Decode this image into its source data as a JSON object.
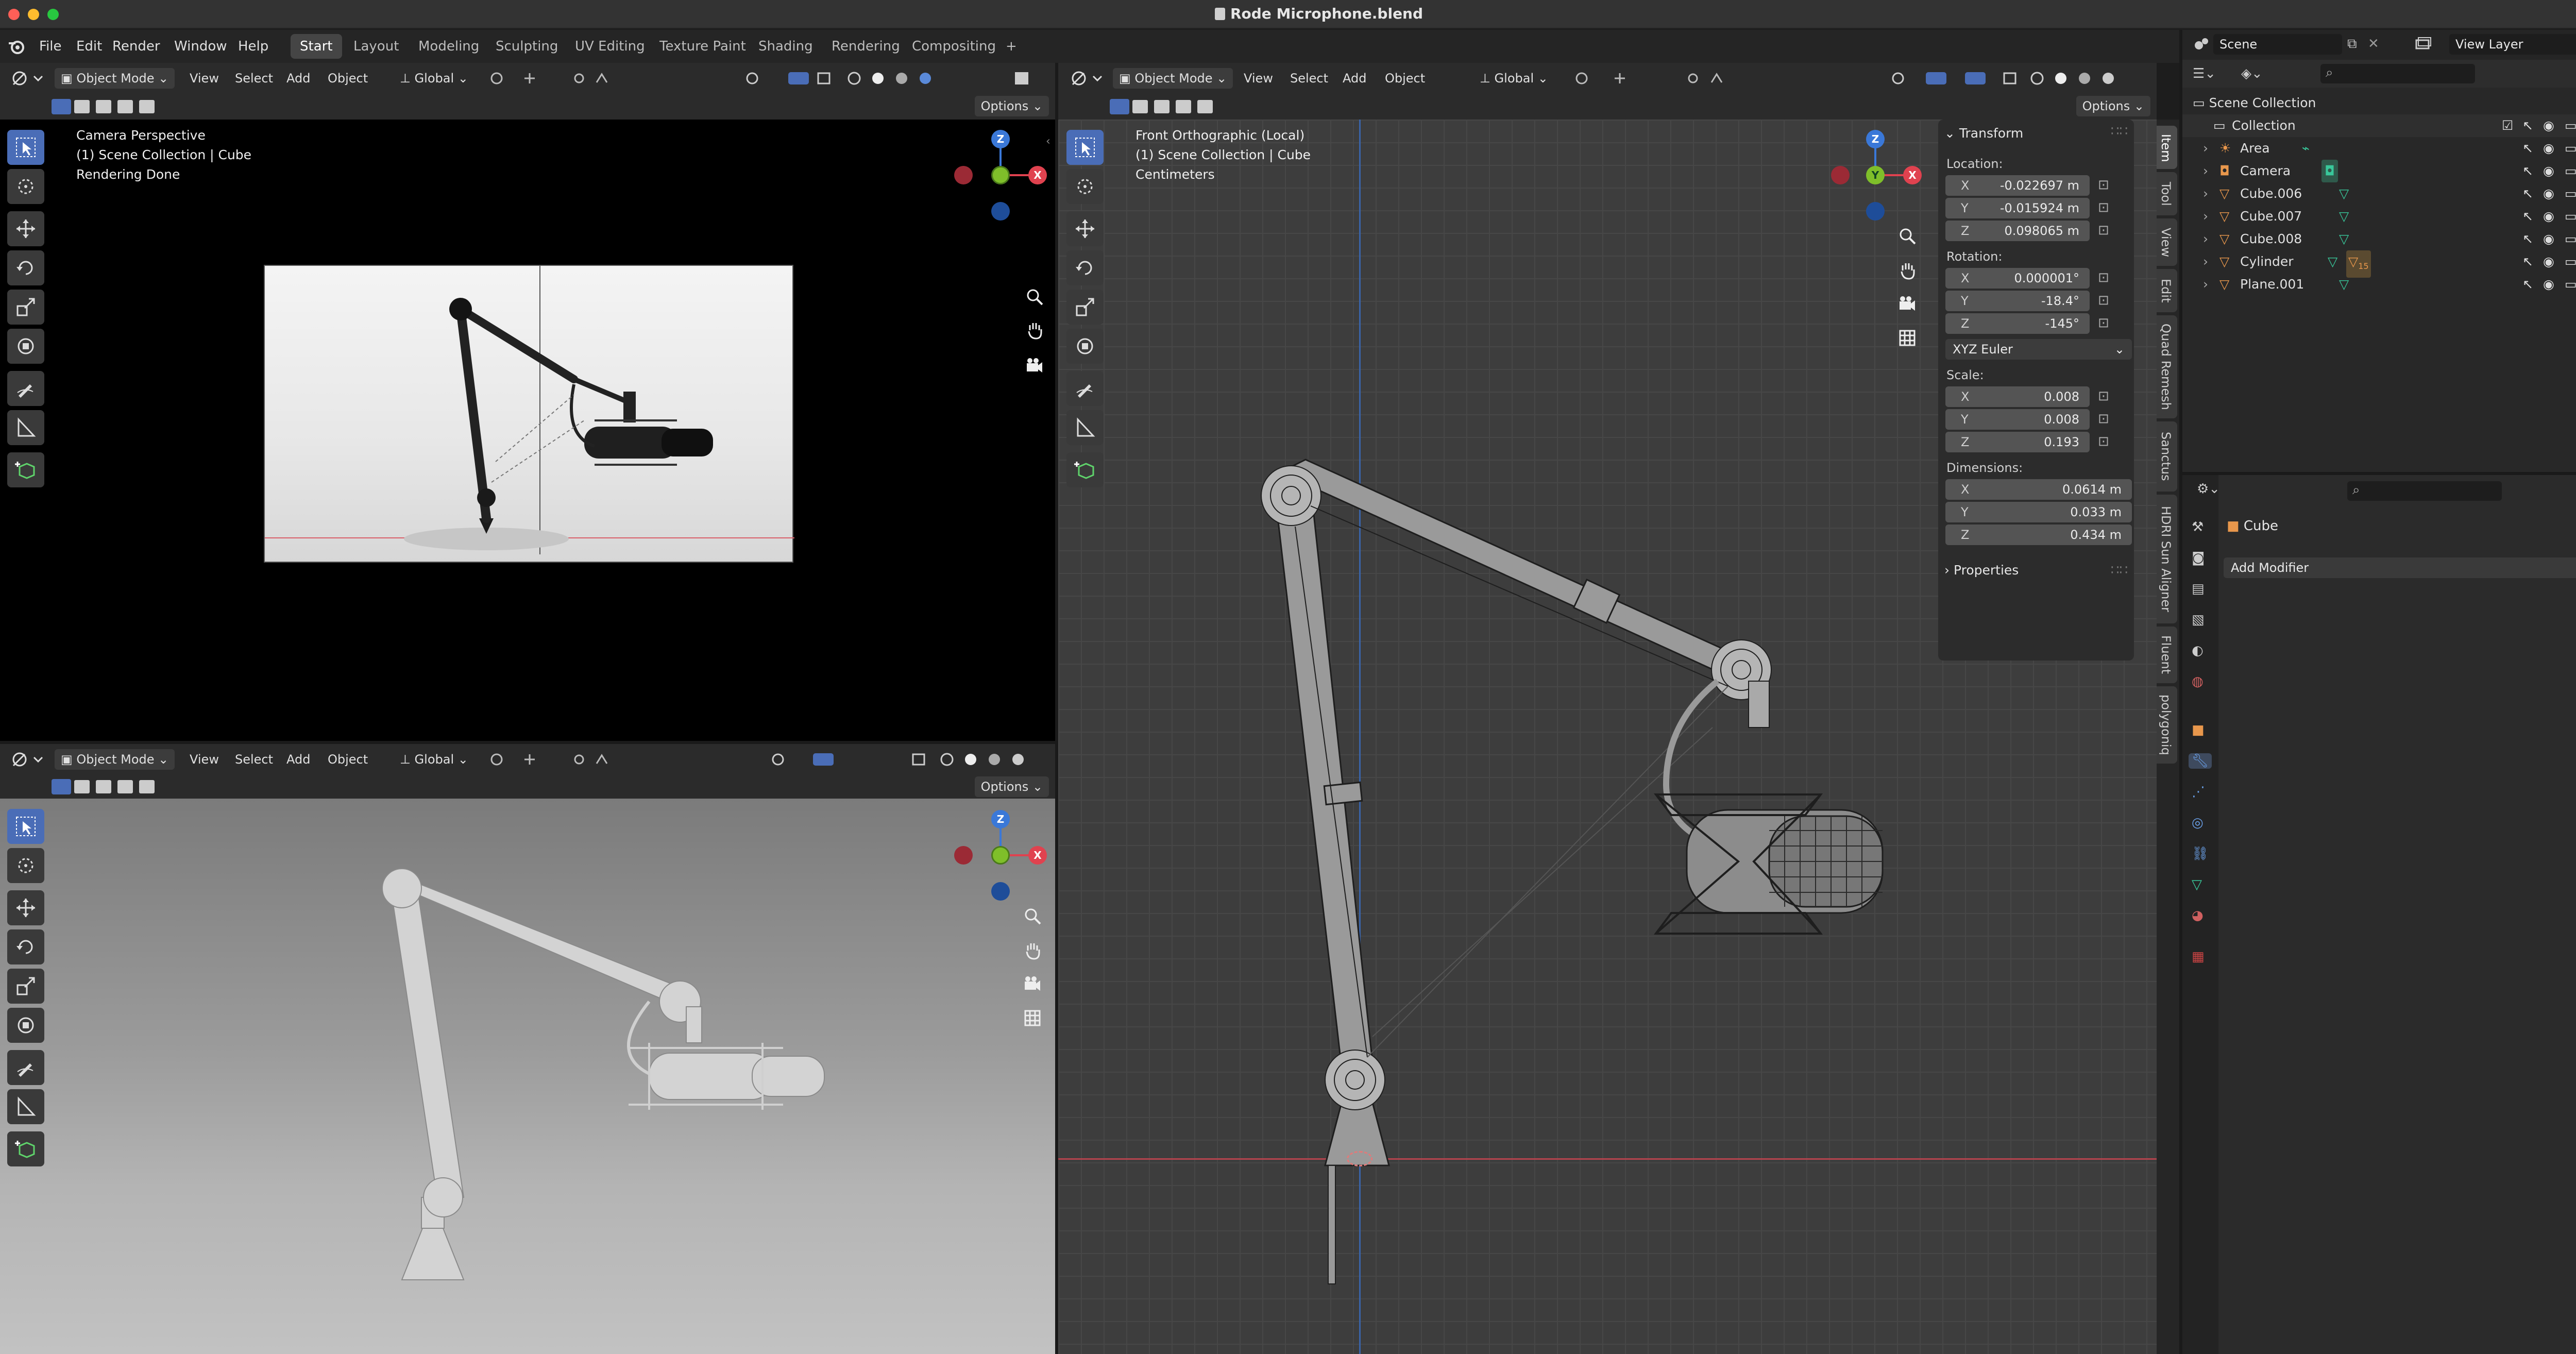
{
  "window": {
    "title": "Rode Microphone.blend"
  },
  "menubar": {
    "menus": [
      "File",
      "Edit",
      "Render",
      "Window",
      "Help"
    ],
    "workspaces": [
      "Start",
      "Layout",
      "Modeling",
      "Sculpting",
      "UV Editing",
      "Texture Paint",
      "Shading",
      "Rendering",
      "Compositing"
    ],
    "active_workspace": "Start",
    "add_workspace": "+"
  },
  "viewport_camera": {
    "mode": "Object Mode",
    "menus": [
      "View",
      "Select",
      "Add",
      "Object"
    ],
    "orientation": "Global",
    "options": "Options",
    "overlay_lines": [
      "Camera Perspective",
      "(1) Scene Collection | Cube",
      "Rendering Done"
    ]
  },
  "viewport_perspective": {
    "mode": "Object Mode",
    "menus": [
      "View",
      "Select",
      "Add",
      "Object"
    ],
    "orientation": "Global",
    "options": "Options"
  },
  "viewport_front": {
    "mode": "Object Mode",
    "menus": [
      "View",
      "Select",
      "Add",
      "Object"
    ],
    "orientation": "Global",
    "options": "Options",
    "overlay_lines": [
      "Front Orthographic (Local)",
      "(1) Scene Collection | Cube",
      "Centimeters"
    ]
  },
  "gizmo": {
    "x": "X",
    "y": "Y",
    "z": "Z"
  },
  "npanel": {
    "section_transform": "Transform",
    "location_label": "Location:",
    "location": {
      "x": "-0.022697 m",
      "y": "-0.015924 m",
      "z": "0.098065 m"
    },
    "rotation_label": "Rotation:",
    "rotation": {
      "x": "0.000001°",
      "y": "-18.4°",
      "z": "-145°"
    },
    "rotation_mode": "XYZ Euler",
    "scale_label": "Scale:",
    "scale": {
      "x": "0.008",
      "y": "0.008",
      "z": "0.193"
    },
    "dimensions_label": "Dimensions:",
    "dimensions": {
      "x": "0.0614 m",
      "y": "0.033 m",
      "z": "0.434 m"
    },
    "section_properties": "Properties",
    "axis_labels": {
      "x": "X",
      "y": "Y",
      "z": "Z"
    },
    "tabs": [
      "Item",
      "Tool",
      "View",
      "Edit",
      "Quad Remesh",
      "Sanctus",
      "HDRI Sun Aligner",
      "Fluent",
      "polygoniq"
    ],
    "active_tab": "Item"
  },
  "topright": {
    "scene": "Scene",
    "view_layer": "View Layer"
  },
  "outliner": {
    "root": "Scene Collection",
    "collection": "Collection",
    "items": [
      "Area",
      "Camera",
      "Cube.006",
      "Cube.007",
      "Cube.008",
      "Cylinder",
      "Plane.001"
    ],
    "item_icons": [
      "light-icon",
      "camera-icon",
      "mesh-icon",
      "mesh-icon",
      "mesh-icon",
      "mesh-icon",
      "mesh-icon"
    ],
    "cylinder_badge": "15"
  },
  "properties": {
    "object_name": "Cube",
    "add_modifier": "Add Modifier"
  },
  "colors": {
    "accent_blue": "#4a6db7",
    "axis_x": "#e0424f",
    "axis_y": "#7fbf2a",
    "axis_z": "#3a78d8",
    "object_orange": "#e8974c",
    "mesh_green": "#39c79a"
  }
}
